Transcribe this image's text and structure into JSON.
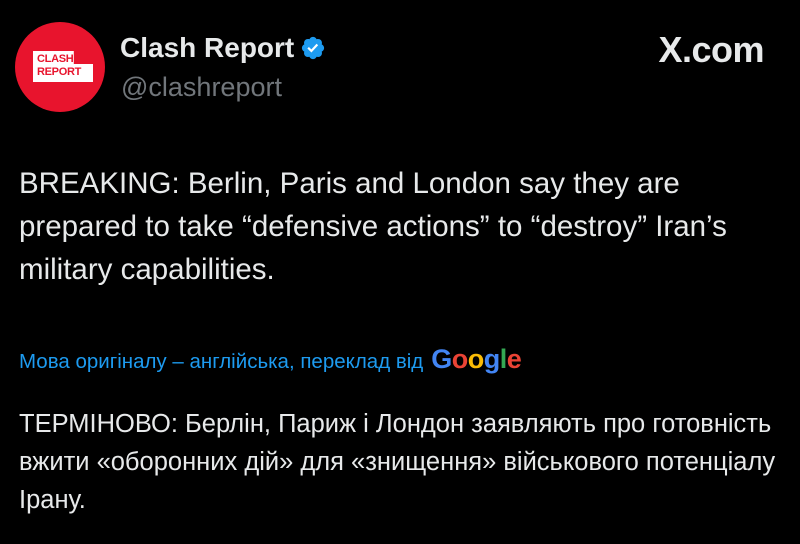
{
  "colors": {
    "background": "#000000",
    "text": "#e7e9ea",
    "secondary": "#71767b",
    "link": "#1d9bf0",
    "avatar_red": "#e8142d",
    "verified_blue": "#1d9bf0"
  },
  "author": {
    "avatar_line1": "CLASH",
    "avatar_line2": "REPORT",
    "display_name": "Clash Report",
    "verified_icon": "verified-badge-icon",
    "handle": "@clashreport"
  },
  "site_label": "X.com",
  "tweet_text": "BREAKING: Berlin, Paris and London say they are prepared to take “defensive actions” to “destroy” Iran’s military capabilities.",
  "translation_bar": {
    "label": "Мова оригіналу – англійська, переклад від",
    "provider_logo": "Google"
  },
  "translated_text": "ТЕРМІНОВО: Берлін, Париж і Лондон заявляють про готовність вжити «оборонних дій» для «знищення» військового потенціалу Ірану."
}
